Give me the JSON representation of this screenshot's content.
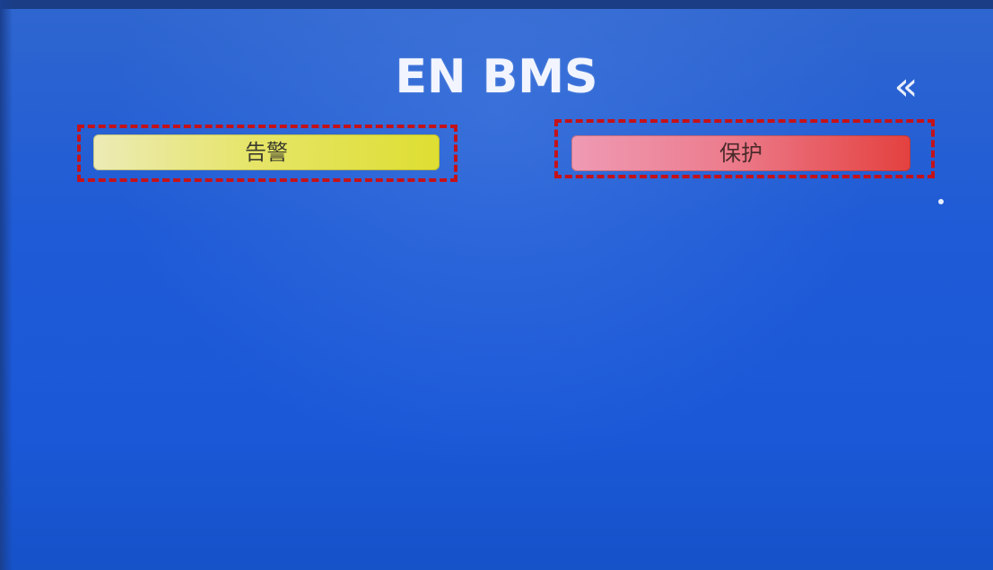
{
  "screen": {
    "title": "EN BMS",
    "back_glyph": "«",
    "back_icon": "double-chevron-left-icon"
  },
  "buttons": {
    "alarm_label": "告警",
    "protect_label": "保护"
  },
  "colors": {
    "background": "#1a58d8",
    "alarm_button": "#e6e56a",
    "protect_button": "#ec7d8e",
    "highlight_frame": "#c4121a"
  }
}
